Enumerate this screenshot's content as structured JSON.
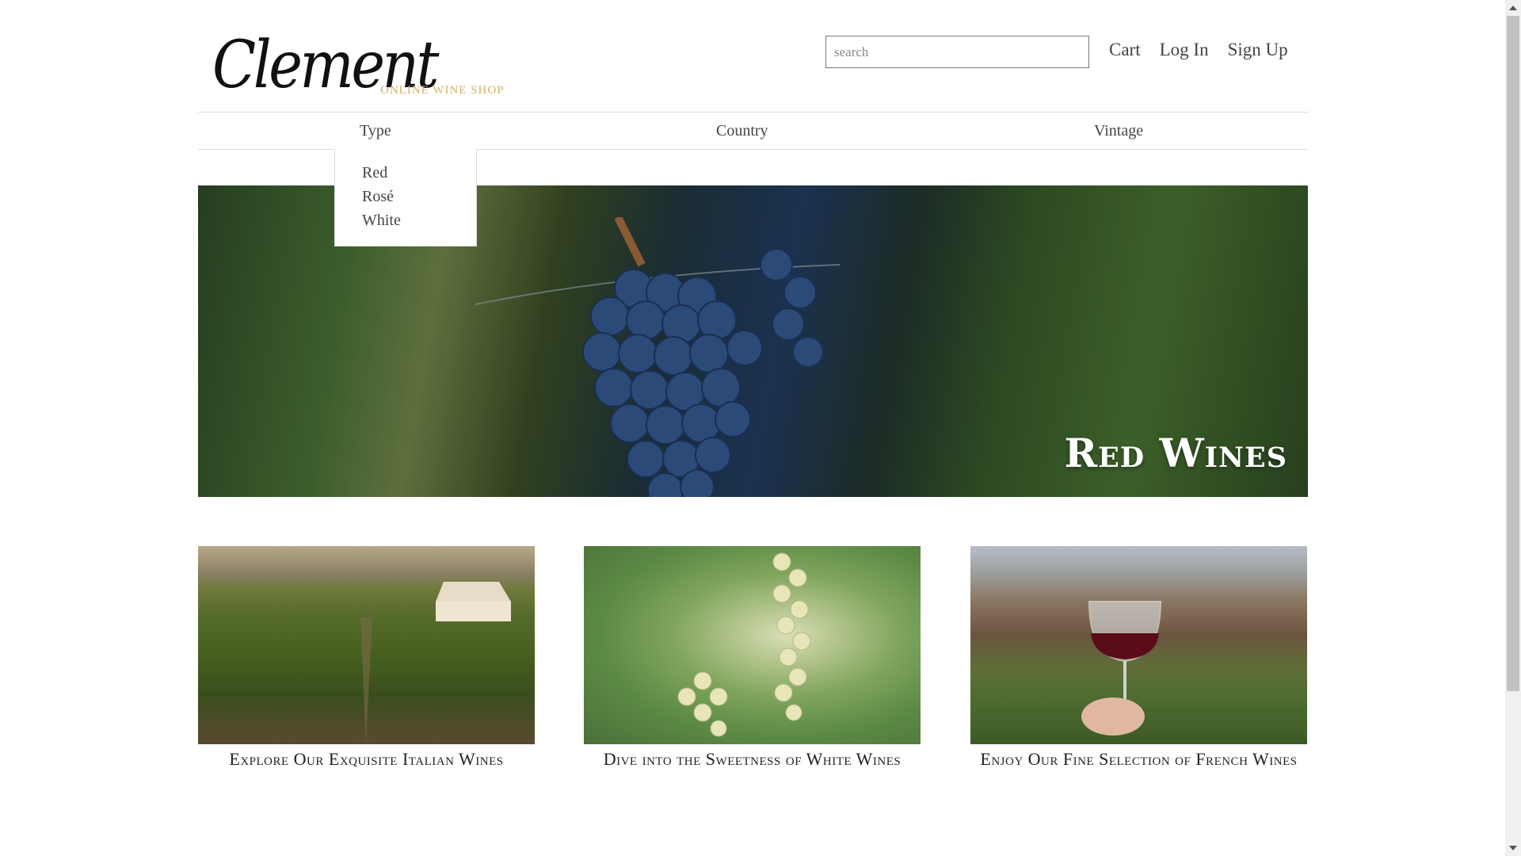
{
  "header": {
    "logo_text": "Clement",
    "tagline": "ONLINE WINE SHOP",
    "search_placeholder": "search",
    "nav": {
      "cart": "Cart",
      "login": "Log In",
      "signup": "Sign Up"
    }
  },
  "categories": {
    "type": "Type",
    "country": "Country",
    "vintage": "Vintage"
  },
  "type_dropdown": {
    "items": [
      "Red",
      "Rosé",
      "White"
    ]
  },
  "hero": {
    "title": "Red Wines"
  },
  "cards": [
    {
      "caption": "Explore Our Exquisite Italian Wines"
    },
    {
      "caption": "Dive into the Sweetness of White Wines"
    },
    {
      "caption": "Enjoy Our Fine Selection of French Wines"
    }
  ],
  "colors": {
    "tagline": "#d4b06b",
    "border": "#dddddd",
    "text": "#444444"
  }
}
